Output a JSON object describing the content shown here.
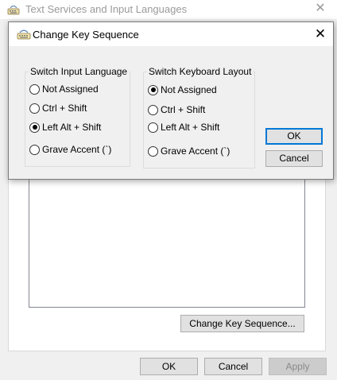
{
  "background": {
    "title": "Text Services and Input Languages",
    "close_glyph": "✕",
    "change_key_sequence_label": "Change Key Sequence...",
    "ok_label": "OK",
    "cancel_label": "Cancel",
    "apply_label": "Apply"
  },
  "dialog": {
    "title": "Change Key Sequence",
    "close_glyph": "✕",
    "ok_label": "OK",
    "cancel_label": "Cancel",
    "input_language_group": {
      "legend": "Switch Input Language",
      "options": [
        "Not Assigned",
        "Ctrl + Shift",
        "Left Alt + Shift",
        "Grave Accent (`)"
      ],
      "selected": "Left Alt + Shift"
    },
    "keyboard_layout_group": {
      "legend": "Switch Keyboard Layout",
      "options": [
        "Not Assigned",
        "Ctrl + Shift",
        "Left Alt + Shift",
        "Grave Accent (`)"
      ],
      "selected": "Not Assigned"
    }
  },
  "icons": {
    "app": "keyboard-icon",
    "close": "close-icon"
  },
  "colors": {
    "default_button_border": "#0078d7",
    "window_bg": "#f0f0f0"
  }
}
